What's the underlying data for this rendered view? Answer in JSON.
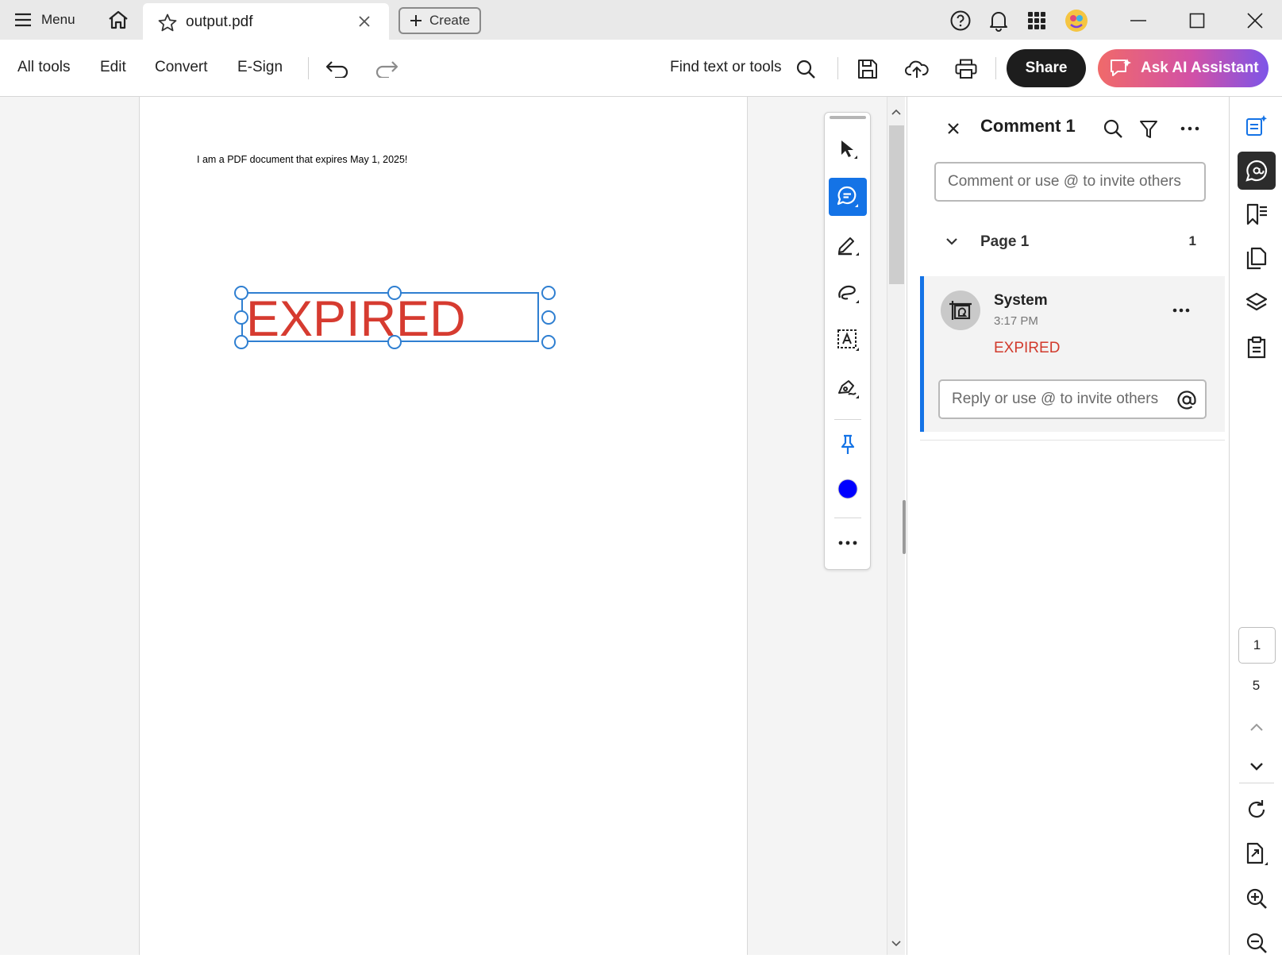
{
  "titlebar": {
    "menu_label": "Menu",
    "tab_title": "output.pdf",
    "create_label": "Create"
  },
  "toolbar": {
    "nav": [
      "All tools",
      "Edit",
      "Convert",
      "E-Sign"
    ],
    "find_label": "Find text or tools",
    "share_label": "Share",
    "ai_label": "Ask AI Assistant"
  },
  "document": {
    "body_text": "I am a PDF document that expires May 1, 2025!",
    "stamp_text": "EXPIRED",
    "stamp_color": "#d63b30",
    "selection_color": "#2f7fd1"
  },
  "floating_tools": {
    "active_tool": "comment",
    "color_swatch": "#0000ff"
  },
  "comments_panel": {
    "title": "Comment 1",
    "comment_placeholder": "Comment or use @ to invite others",
    "page_label": "Page 1",
    "page_comment_count": "1",
    "comment": {
      "author": "System",
      "time": "3:17 PM",
      "text": "EXPIRED"
    },
    "reply_placeholder": "Reply or use @ to invite others"
  },
  "page_nav": {
    "current_page": "1",
    "total_pages": "5"
  },
  "colors": {
    "accent": "#1473e6",
    "share_bg": "#1d1d1d"
  }
}
